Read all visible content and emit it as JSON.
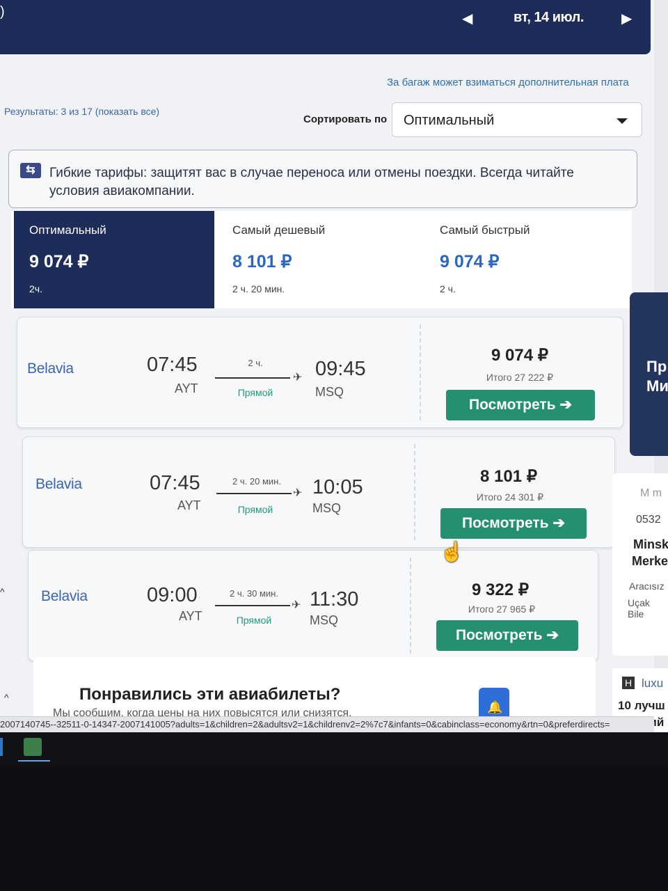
{
  "header": {
    "edge_glyph": ")",
    "nav_prev": "◀",
    "date": "вт, 14 июл.",
    "nav_next": "▶"
  },
  "baggage_note": "За багаж может взиматься дополнительная плата",
  "results": "Результаты: 3 из 17 (показать все)",
  "sort": {
    "label": "Сортировать по",
    "value": "Оптимальный"
  },
  "notice": {
    "icon": "flexible-tariff-icon",
    "text": "Гибкие тарифы: защитят вас в случае переноса или отмены поездки. Всегда читайте условия авиакомпании."
  },
  "tabs": [
    {
      "label": "Оптимальный",
      "price": "9 074 ₽",
      "duration": "2ч."
    },
    {
      "label": "Самый дешевый",
      "price": "8 101 ₽",
      "duration": "2 ч. 20 мин."
    },
    {
      "label": "Самый быстрый",
      "price": "9 074 ₽",
      "duration": "2 ч."
    }
  ],
  "flights": [
    {
      "airline": "Belavia",
      "dep_time": "07:45",
      "dep_code": "AYT",
      "duration": "2 ч.",
      "type": "Прямой",
      "arr_time": "09:45",
      "arr_code": "MSQ",
      "price": "9 074 ₽",
      "total": "Итого 27 222 ₽",
      "button": "Посмотреть ➔"
    },
    {
      "airline": "Belavia",
      "dep_time": "07:45",
      "dep_code": "AYT",
      "duration": "2 ч. 20 мин.",
      "type": "Прямой",
      "arr_time": "10:05",
      "arr_code": "MSQ",
      "price": "8 101 ₽",
      "total": "Итого 24 301 ₽",
      "button": "Посмотреть ➔"
    },
    {
      "airline": "Belavia",
      "dep_time": "09:00",
      "dep_code": "AYT",
      "duration": "2 ч. 30 мин.",
      "type": "Прямой",
      "arr_time": "11:30",
      "arr_code": "MSQ",
      "price": "9 322 ₽",
      "total": "Итого 27 965 ₽",
      "button": "Посмотреть ➔"
    }
  ],
  "promo": {
    "title": "Понравились эти авиабилеты?",
    "subtitle": "Мы сообщим, когда цены на них повысятся или снизятся."
  },
  "side_ad": {
    "line1": "Пр",
    "line2": "Ми"
  },
  "side_card": {
    "logo": "M m",
    "phone": "0532",
    "city1": "Minsk",
    "city2": "Merke",
    "text1": "Aracısız",
    "text2": "Uçak Bile"
  },
  "side_bottom": {
    "badge": "H",
    "brand": "luxu",
    "line1": "10 лучш",
    "line2": "Лучший"
  },
  "status_url": "2007140745--32511-0-14347-2007141005?adults=1&children=2&adultsv2=1&childrenv2=2%7c7&infants=0&cabinclass=economy&rtn=0&preferdirects=",
  "chevrons": [
    "^",
    "^"
  ],
  "cursor": "☝"
}
